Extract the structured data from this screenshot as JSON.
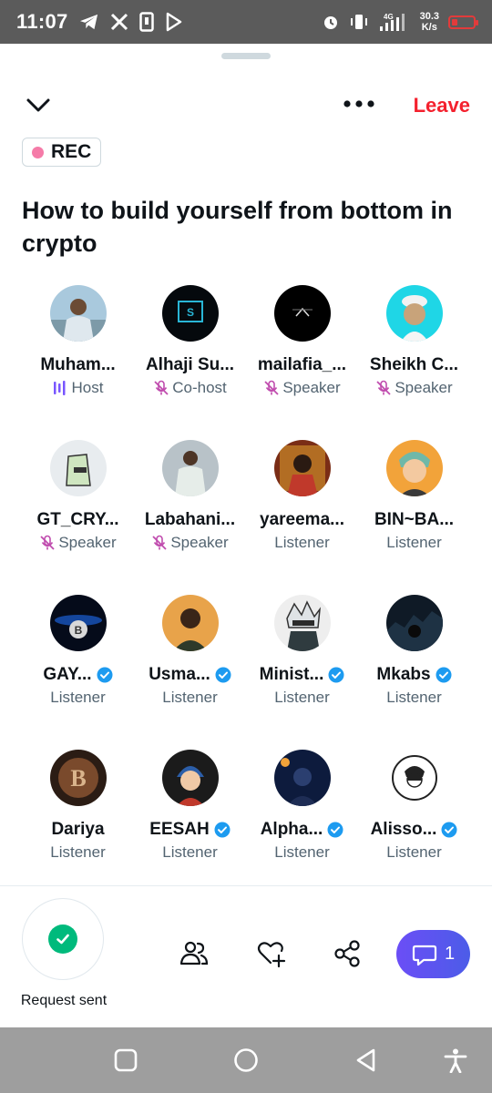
{
  "status_bar": {
    "time": "11:07",
    "network_speed_value": "30.3",
    "network_speed_unit": "K/s",
    "network_type": "4G",
    "left_icons": [
      "telegram-icon",
      "x-icon",
      "sim-icon",
      "play-store-icon"
    ],
    "right_icons": [
      "alarm-icon",
      "vibrate-icon",
      "signal-icon",
      "battery-icon"
    ]
  },
  "header": {
    "more_icon": "more-dots-icon",
    "collapse_icon": "chevron-down-icon",
    "leave_label": "Leave"
  },
  "rec_badge": {
    "label": "REC"
  },
  "space_title": "How to build yourself from bottom in crypto",
  "participants": [
    {
      "name": "Muham...",
      "role": "Host",
      "role_icon": "speaking-bars-icon",
      "verified": false
    },
    {
      "name": "Alhaji Su...",
      "role": "Co-host",
      "role_icon": "mic-off-icon",
      "verified": false
    },
    {
      "name": "mailafia_...",
      "role": "Speaker",
      "role_icon": "mic-off-icon",
      "verified": false
    },
    {
      "name": "Sheikh C...",
      "role": "Speaker",
      "role_icon": "mic-off-icon",
      "verified": false
    },
    {
      "name": "GT_CRY...",
      "role": "Speaker",
      "role_icon": "mic-off-icon",
      "verified": false
    },
    {
      "name": "Labahani...",
      "role": "Speaker",
      "role_icon": "mic-off-icon",
      "verified": false
    },
    {
      "name": "yareema...",
      "role": "Listener",
      "role_icon": "",
      "verified": false
    },
    {
      "name": "BIN~BA...",
      "role": "Listener",
      "role_icon": "",
      "verified": false
    },
    {
      "name": "GAY...",
      "role": "Listener",
      "role_icon": "",
      "verified": true
    },
    {
      "name": "Usma...",
      "role": "Listener",
      "role_icon": "",
      "verified": true
    },
    {
      "name": "Minist...",
      "role": "Listener",
      "role_icon": "",
      "verified": true
    },
    {
      "name": "Mkabs",
      "role": "Listener",
      "role_icon": "",
      "verified": true
    },
    {
      "name": "Dariya",
      "role": "Listener",
      "role_icon": "",
      "verified": false
    },
    {
      "name": "EESAH",
      "role": "Listener",
      "role_icon": "",
      "verified": true
    },
    {
      "name": "Alpha...",
      "role": "Listener",
      "role_icon": "",
      "verified": true
    },
    {
      "name": "Alisso...",
      "role": "Listener",
      "role_icon": "",
      "verified": true
    }
  ],
  "bottom_bar": {
    "request_label": "Request sent",
    "icons": [
      "participants-icon",
      "heart-plus-icon",
      "share-icon"
    ],
    "chat_count": "1"
  },
  "nav_bar": {
    "icons": [
      "recents-square-icon",
      "home-circle-icon",
      "back-triangle-icon",
      "accessibility-icon"
    ]
  },
  "colors": {
    "accent_red": "#f4212e",
    "host_purple": "#7856ff",
    "mic_off_pink": "#c04cae",
    "verified_blue": "#1d9bf0",
    "rec_pink": "#f57ba8",
    "success_green": "#00ba7c"
  }
}
